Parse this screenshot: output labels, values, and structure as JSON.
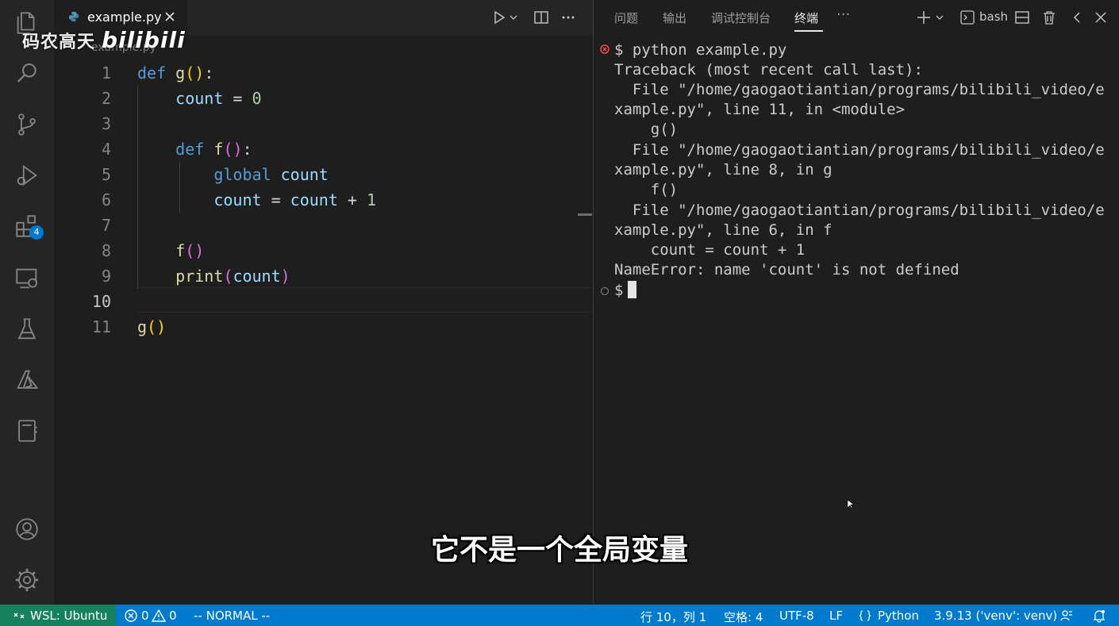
{
  "editor": {
    "tab_label": "example.py",
    "breadcrumb": "example.py",
    "line_numbers": [
      "1",
      "2",
      "3",
      "4",
      "5",
      "6",
      "7",
      "8",
      "9",
      "10",
      "11"
    ],
    "current_line": "10",
    "code": {
      "l1": {
        "kw": "def",
        "fn": "g",
        "p1": "(",
        "p2": ")",
        "colon": ":"
      },
      "l2": {
        "v": "count",
        "op": " = ",
        "n": "0"
      },
      "l4": {
        "kw": "def",
        "fn": "f",
        "p1": "(",
        "p2": ")",
        "colon": ":"
      },
      "l5": {
        "kw": "global",
        "v": "count"
      },
      "l6": {
        "v1": "count",
        "op1": " = ",
        "v2": "count",
        "op2": " + ",
        "n": "1"
      },
      "l8": {
        "fn": "f",
        "p1": "(",
        "p2": ")"
      },
      "l9": {
        "fn": "print",
        "p1": "(",
        "v": "count",
        "p2": ")"
      },
      "l11": {
        "fn": "g",
        "p1": "(",
        "p2": ")"
      }
    }
  },
  "watermark": {
    "text": "码农高天",
    "brand": "bilibili"
  },
  "panel": {
    "tabs": [
      "问题",
      "输出",
      "调试控制台",
      "终端"
    ],
    "active_tab": "终端",
    "more": "···",
    "shell": "bash"
  },
  "terminal": {
    "lines": [
      "$ python example.py",
      "Traceback (most recent call last):",
      "  File \"/home/gaogaotiantian/programs/bilibili_video/e",
      "xample.py\", line 11, in <module>",
      "    g()",
      "  File \"/home/gaogaotiantian/programs/bilibili_video/e",
      "xample.py\", line 8, in g",
      "    f()",
      "  File \"/home/gaogaotiantian/programs/bilibili_video/e",
      "xample.py\", line 6, in f",
      "    count = count + 1",
      "NameError: name 'count' is not defined"
    ],
    "prompt": "$"
  },
  "subtitle": "它不是一个全局变量",
  "activity": {
    "extensions_badge": "4"
  },
  "status": {
    "remote": "WSL: Ubuntu",
    "errors": "0",
    "warnings": "0",
    "mode": "-- NORMAL --",
    "position": "行 10，列 1",
    "spaces": "空格: 4",
    "encoding": "UTF-8",
    "eol": "LF",
    "language": "Python",
    "interpreter": "3.9.13 ('venv': venv)"
  },
  "colors": {
    "status_bar": "#007acc",
    "remote": "#16825d",
    "keyword": "#569cd6",
    "function": "#dcdcaa",
    "variable": "#9cdcfe",
    "number": "#b5cea8",
    "error": "#f14c4c"
  }
}
